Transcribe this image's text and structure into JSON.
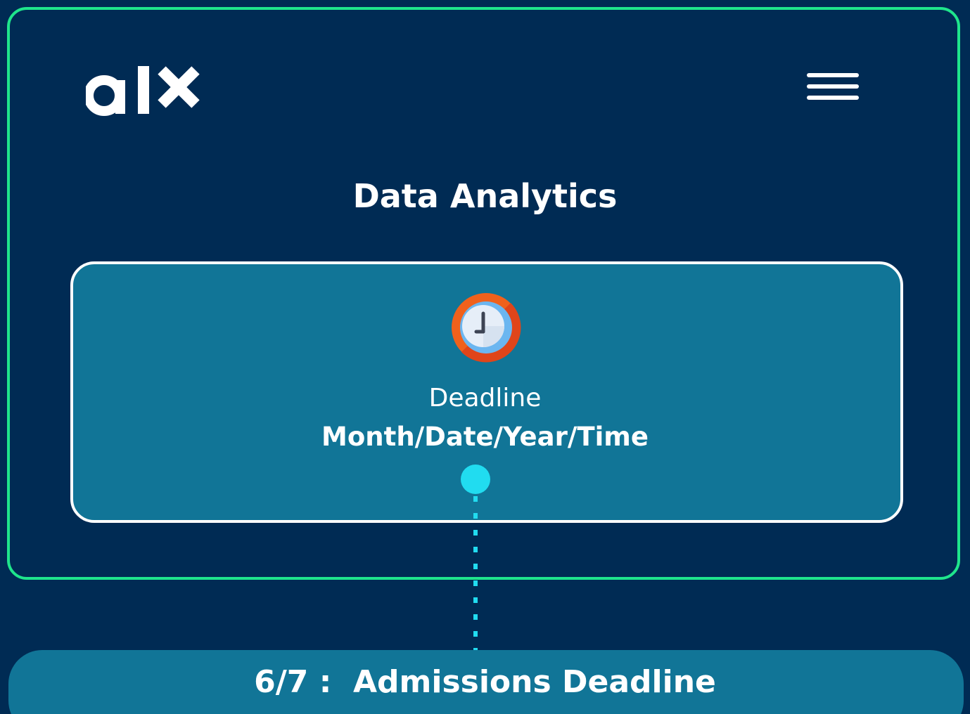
{
  "header": {
    "logo_text": "alx",
    "menu_icon": "hamburger-menu-icon"
  },
  "page": {
    "title": "Data Analytics"
  },
  "deadline_card": {
    "icon": "clock-icon",
    "label": "Deadline",
    "value": "Month/Date/Year/Time"
  },
  "timeline": {
    "event_text": "6/7 :  Admissions Deadline"
  },
  "colors": {
    "background": "#002b54",
    "frame_border": "#1fe58c",
    "card": "#117597",
    "timeline_accent": "#21dcf0",
    "text": "#ffffff"
  }
}
